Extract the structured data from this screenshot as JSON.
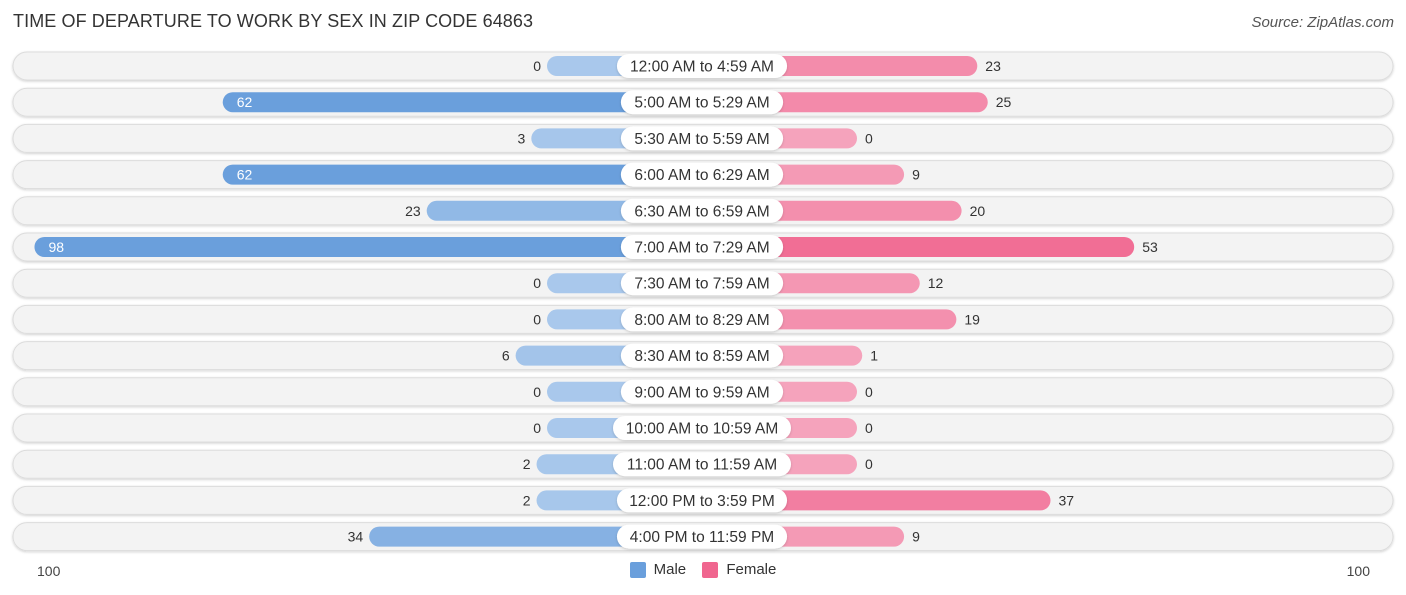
{
  "header": {
    "title": "TIME OF DEPARTURE TO WORK BY SEX IN ZIP CODE 64863",
    "source": "Source: ZipAtlas.com"
  },
  "colors": {
    "male": "#6a9fdc",
    "male_light": "#a9c8ec",
    "female": "#f0668f",
    "female_light": "#f5a3bc",
    "row_bg": "#f3f3f3"
  },
  "legend": {
    "male_label": "Male",
    "female_label": "Female"
  },
  "axis": {
    "left_label": "100",
    "right_label": "100"
  },
  "chart_data": {
    "type": "bar",
    "orientation": "horizontal-diverging",
    "title": "TIME OF DEPARTURE TO WORK BY SEX IN ZIP CODE 64863",
    "xlabel": "",
    "ylabel": "",
    "xlim": [
      -100,
      100
    ],
    "legend_position": "bottom-center",
    "categories": [
      "12:00 AM to 4:59 AM",
      "5:00 AM to 5:29 AM",
      "5:30 AM to 5:59 AM",
      "6:00 AM to 6:29 AM",
      "6:30 AM to 6:59 AM",
      "7:00 AM to 7:29 AM",
      "7:30 AM to 7:59 AM",
      "8:00 AM to 8:29 AM",
      "8:30 AM to 8:59 AM",
      "9:00 AM to 9:59 AM",
      "10:00 AM to 10:59 AM",
      "11:00 AM to 11:59 AM",
      "12:00 PM to 3:59 PM",
      "4:00 PM to 11:59 PM"
    ],
    "series": [
      {
        "name": "Male",
        "values": [
          0,
          62,
          3,
          62,
          23,
          98,
          0,
          0,
          6,
          0,
          0,
          2,
          2,
          34
        ]
      },
      {
        "name": "Female",
        "values": [
          23,
          25,
          0,
          9,
          20,
          53,
          12,
          19,
          1,
          0,
          0,
          0,
          37,
          9
        ]
      }
    ]
  }
}
